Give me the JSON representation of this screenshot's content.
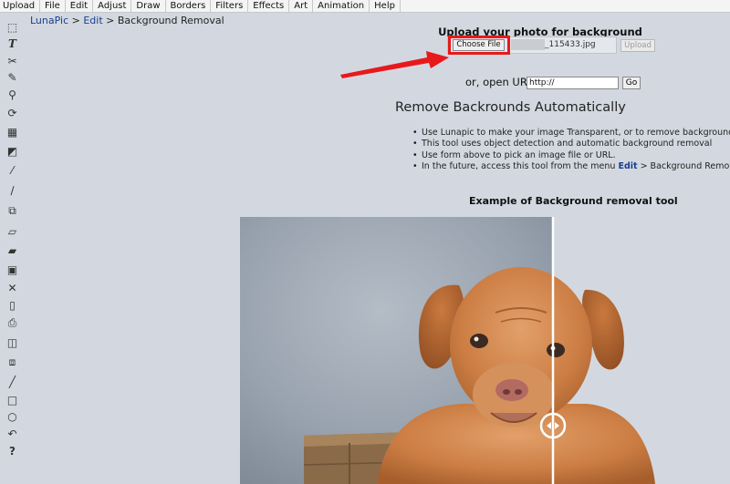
{
  "menubar": {
    "items": [
      "Upload",
      "File",
      "Edit",
      "Adjust",
      "Draw",
      "Borders",
      "Filters",
      "Effects",
      "Art",
      "Animation",
      "Help"
    ]
  },
  "toolbar": {
    "tools": [
      {
        "icon": "marquee-select-icon",
        "glyph": "⬚"
      },
      {
        "icon": "text-tool-icon",
        "glyph": "T"
      },
      {
        "icon": "scissors-icon",
        "glyph": "✂"
      },
      {
        "icon": "pencil-icon",
        "glyph": "✎"
      },
      {
        "icon": "zoom-icon",
        "glyph": "⚲"
      },
      {
        "icon": "rotate-icon",
        "glyph": "⟳"
      },
      {
        "icon": "canvas-icon",
        "glyph": "▦"
      },
      {
        "icon": "paint-bucket-icon",
        "glyph": "◩"
      },
      {
        "icon": "eyedropper-icon",
        "glyph": "⁄"
      },
      {
        "icon": "brush-icon",
        "glyph": "∕"
      },
      {
        "icon": "crop-icon",
        "glyph": "⧉"
      },
      {
        "icon": "eraser-icon",
        "glyph": "▱"
      },
      {
        "icon": "open-folder-icon",
        "glyph": "▰"
      },
      {
        "icon": "save-icon",
        "glyph": "▣"
      },
      {
        "icon": "close-icon",
        "glyph": "✕"
      },
      {
        "icon": "new-file-icon",
        "glyph": "▯"
      },
      {
        "icon": "print-icon",
        "glyph": "⎙"
      },
      {
        "icon": "layers-icon",
        "glyph": "◫"
      },
      {
        "icon": "copy-icon",
        "glyph": "⧈"
      },
      {
        "icon": "line-icon",
        "glyph": "╱"
      },
      {
        "icon": "rectangle-icon",
        "glyph": "□"
      },
      {
        "icon": "circle-icon",
        "glyph": "○"
      },
      {
        "icon": "undo-icon",
        "glyph": "↶"
      },
      {
        "icon": "help-icon",
        "glyph": "?"
      }
    ]
  },
  "breadcrumb": {
    "home": "LunaPic",
    "sep1": " > ",
    "section": "Edit",
    "sep2": " > ",
    "current": "Background Removal"
  },
  "upload": {
    "title": "Upload your photo for background removal",
    "choose_label": "Choose File",
    "filename": "_115433.jpg",
    "upload_label": "Upload"
  },
  "url": {
    "label": "or, open URL",
    "value": "http://",
    "go_label": "Go"
  },
  "main": {
    "title": "Remove Backrounds Automatically",
    "bullets": [
      "Use Lunapic to make your image Transparent, or to remove background.",
      "This tool uses object detection and automatic background removal",
      "Use form above to pick an image file or URL."
    ],
    "last_bullet_prefix": "In the future, access this tool from the menu ",
    "last_bullet_link": "Edit",
    "last_bullet_suffix": " > Background Removal"
  },
  "example": {
    "title": "Example of Background removal tool"
  },
  "colors": {
    "highlight": "#e8191b",
    "link": "#1a3f8f",
    "page_bg": "#d3d8e0"
  }
}
